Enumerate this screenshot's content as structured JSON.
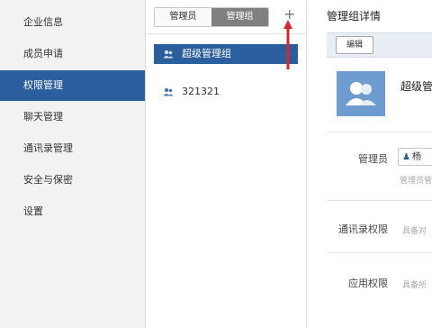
{
  "sidebar": {
    "items": [
      {
        "label": "企业信息"
      },
      {
        "label": "成员申请"
      },
      {
        "label": "权限管理"
      },
      {
        "label": "聊天管理"
      },
      {
        "label": "通讯录管理"
      },
      {
        "label": "安全与保密"
      },
      {
        "label": "设置"
      }
    ],
    "active_index": 2
  },
  "middle": {
    "tabs": [
      {
        "label": "管理员"
      },
      {
        "label": "管理组"
      }
    ],
    "active_tab": 1,
    "add_symbol": "+",
    "groups": [
      {
        "label": "超级管理组",
        "selected": true
      },
      {
        "label": "321321",
        "selected": false
      }
    ]
  },
  "detail": {
    "title": "管理组详情",
    "edit_label": "编辑",
    "group_name": "超级管",
    "admin_label": "管理员",
    "admin_chip": "杨",
    "admin_hint": "管理员管",
    "contacts_perm_label": "通讯录权限",
    "contacts_perm_hint": "具备对",
    "app_perm_label": "应用权限",
    "app_perm_hint": "具备所"
  },
  "colors": {
    "accent": "#2b5e9c",
    "annotation_arrow": "#d9262b",
    "avatar_bg": "#6f9ccf"
  }
}
